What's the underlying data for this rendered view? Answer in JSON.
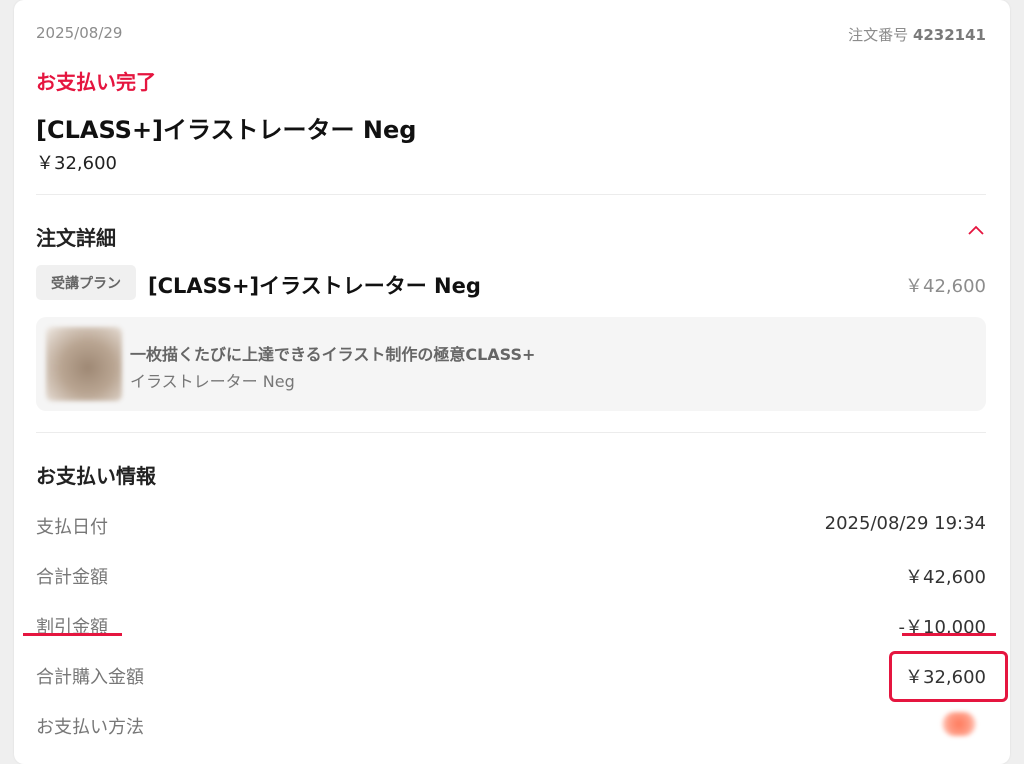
{
  "order": {
    "date": "2025/08/29",
    "order_no_label": "注文番号",
    "order_no": "4232141",
    "status": "お支払い完了",
    "title": "[CLASS+]イラストレーター Neg",
    "paid_amount": "￥32,600"
  },
  "details": {
    "heading": "注文詳細",
    "toggle_icon": "chevron-up-icon",
    "plan_tag": "受講プラン",
    "item_name": "[CLASS+]イラストレーター Neg",
    "item_price": "￥42,600",
    "course": {
      "title": "一枚描くたびに上達できるイラスト制作の極意CLASS+",
      "instructor": "イラストレーター Neg"
    }
  },
  "payment": {
    "heading": "お支払い情報",
    "rows": [
      {
        "label": "支払日付",
        "value": "2025/08/29 19:34"
      },
      {
        "label": "合計金額",
        "value": "￥42,600"
      },
      {
        "label": "割引金額",
        "value": "-￥10,000"
      },
      {
        "label": "合計購入金額",
        "value": "￥32,600"
      },
      {
        "label": "お支払い方法",
        "value": ""
      }
    ]
  },
  "colors": {
    "accent": "#e5153f",
    "muted_text": "#8c8c8c",
    "background": "#efefef"
  }
}
